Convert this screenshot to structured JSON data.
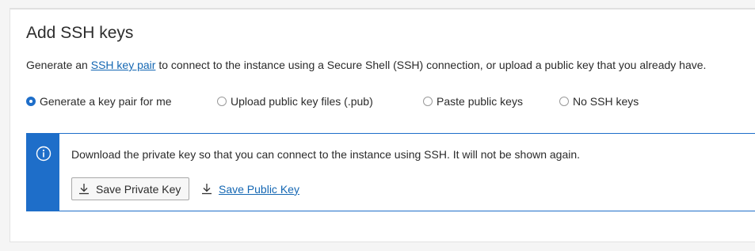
{
  "section": {
    "title": "Add SSH keys",
    "description_prefix": "Generate an ",
    "description_link": "SSH key pair",
    "description_suffix": " to connect to the instance using a Secure Shell (SSH) connection, or upload a public key that you already have."
  },
  "radio_options": [
    {
      "label": "Generate a key pair for me",
      "checked": true
    },
    {
      "label": "Upload public key files (.pub)",
      "checked": false
    },
    {
      "label": "Paste public keys",
      "checked": false
    },
    {
      "label": "No SSH keys",
      "checked": false
    }
  ],
  "notice": {
    "icon": "info-icon",
    "message": "Download the private key so that you can connect to the instance using SSH. It will not be shown again.",
    "save_private_label": "Save Private Key",
    "save_public_label": "Save Public Key"
  },
  "colors": {
    "accent": "#1e6ec9",
    "link": "#1467b3"
  }
}
